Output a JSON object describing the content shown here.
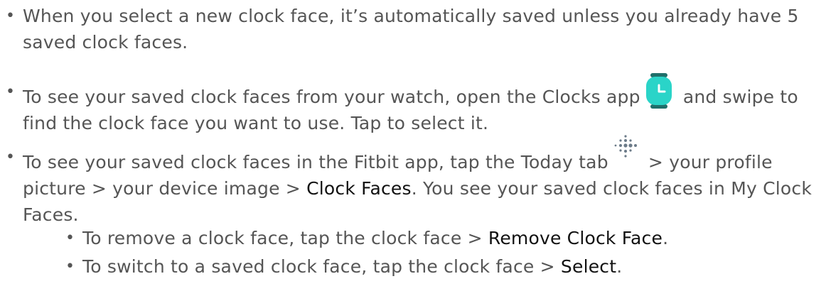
{
  "bullets": [
    {
      "text": "When you select a new clock face, it’s automatically saved unless you already have 5 saved clock faces."
    },
    {
      "text_before_icon": "To see your saved clock faces from your watch, open the Clocks app",
      "icon": "clocks-app-icon",
      "text_after_icon": " and swipe to find the clock face you want to use. Tap to select it."
    },
    {
      "text_before_icon": "To see your saved clock faces in the Fitbit app, tap the Today tab",
      "icon": "fitbit-today-tab-icon",
      "text_after_icon": " > your profile picture > your device image > ",
      "bold_text": "Clock Faces",
      "text_end": ". You see your saved clock faces in My Clock Faces."
    }
  ],
  "sub_bullets": [
    {
      "text": "To remove a clock face, tap the clock face > ",
      "bold_text": "Remove Clock Face",
      "text_end": "."
    },
    {
      "text": "To switch to a saved clock face, tap the clock face > ",
      "bold_text": "Select",
      "text_end": "."
    }
  ],
  "bullet_glyph": "•",
  "colors": {
    "body_text": "#555555",
    "bold_text": "#111111",
    "clock_icon_teal": "#2ad4c8",
    "clock_icon_dark": "#1f6f6a",
    "fitbit_dots": "#6b7a88"
  }
}
